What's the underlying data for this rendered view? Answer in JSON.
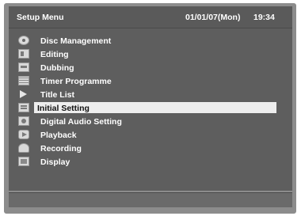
{
  "header": {
    "title": "Setup Menu",
    "date": "01/01/07(Mon)",
    "time": "19:34"
  },
  "menu": {
    "selected": "Initial Setting",
    "items": [
      {
        "label": "Disc Management",
        "icon": "disc-icon"
      },
      {
        "label": "Editing",
        "icon": "editing-icon"
      },
      {
        "label": "Dubbing",
        "icon": "dubbing-icon"
      },
      {
        "label": "Timer Programme",
        "icon": "timer-icon"
      },
      {
        "label": "Title List",
        "icon": "play-arrow-icon"
      },
      {
        "label": "Initial Setting",
        "icon": "initial-setting-icon"
      },
      {
        "label": "Digital Audio Setting",
        "icon": "audio-icon"
      },
      {
        "label": "Playback",
        "icon": "playback-icon"
      },
      {
        "label": "Recording",
        "icon": "recording-icon"
      },
      {
        "label": "Display",
        "icon": "display-icon"
      }
    ]
  },
  "colors": {
    "frame": "#8c8c8c",
    "header_bg": "#5a5a5a",
    "panel_bg": "#5e5e5e",
    "highlight_bg": "#eeeeee",
    "text": "#ffffff"
  }
}
